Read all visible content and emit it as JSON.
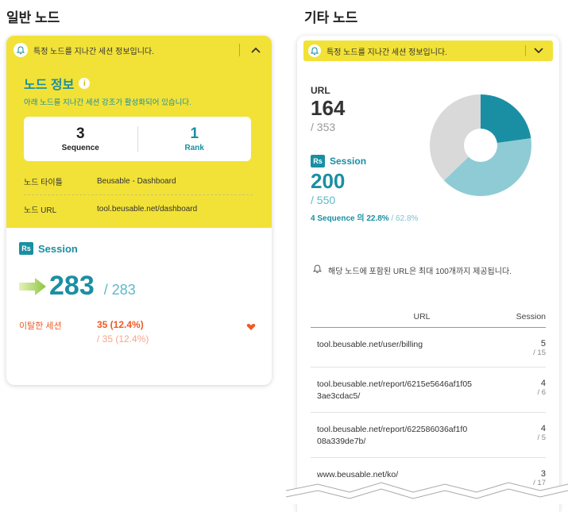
{
  "left": {
    "section_title": "일반 노드",
    "notice": "특정 노드를 지나간 세션 정보입니다.",
    "node_info_title": "노드 정보",
    "node_info_desc": "아래 노드를 지나간 세션 강조가 활성화되어 있습니다.",
    "stats": [
      {
        "value": "3",
        "label": "Sequence"
      },
      {
        "value": "1",
        "label": "Rank"
      }
    ],
    "node_title_key": "노드 타이틀",
    "node_title_value": "Beusable - Dashboard",
    "node_url_key": "노드 URL",
    "node_url_value": "tool.beusable.net/dashboard",
    "session_label": "Session",
    "rs_badge": "Rs",
    "session_count": "283",
    "session_total": "/ 283",
    "exit_label": "이탈한 세션",
    "exit_value": "35  (12.4%)",
    "exit_total": "/ 35  (12.4%)"
  },
  "right": {
    "section_title": "기타 노드",
    "notice": "특정 노드를 지나간 세션 정보입니다.",
    "url_label": "URL",
    "url_count": "164",
    "url_total": "/ 353",
    "session_label": "Session",
    "rs_badge": "Rs",
    "session_count": "200",
    "session_total": "/ 550",
    "seq_text": "4 Sequence 의 22.8%",
    "seq_total": " / 62.8%",
    "note": "해당 노드에 포함된 URL은 최대 100개까지 제공됩니다.",
    "table": {
      "col_url": "URL",
      "col_session": "Session",
      "rows": [
        {
          "url": "tool.beusable.net/user/billing",
          "n": "5",
          "d": "/ 15"
        },
        {
          "url": "tool.beusable.net/report/6215e5646af1f05\n3ae3cdac5/",
          "n": "4",
          "d": "/ 6"
        },
        {
          "url": "tool.beusable.net/report/622586036af1f0\n08a339de7b/",
          "n": "4",
          "d": "/ 5"
        },
        {
          "url": "www.beusable.net/ko/",
          "n": "3",
          "d": "/ 17"
        }
      ]
    },
    "pie": {
      "slices": [
        {
          "name": "dark",
          "value": 22.8,
          "color": "#1a8fa3"
        },
        {
          "name": "light",
          "value": 40.0,
          "color": "#8fcbd5"
        },
        {
          "name": "grey",
          "value": 37.2,
          "color": "#d9d9d9"
        }
      ]
    }
  },
  "colors": {
    "accent": "#1a8fa3",
    "yellow": "#f2e237",
    "exit": "#ee5a24"
  }
}
